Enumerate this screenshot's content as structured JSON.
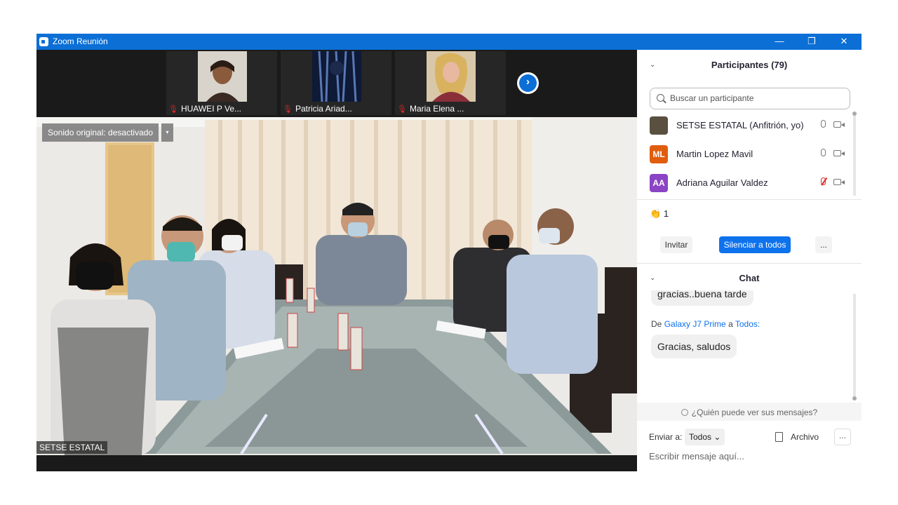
{
  "window": {
    "title": "Zoom Reunión",
    "minimize": "—",
    "restore": "❐",
    "close": "✕"
  },
  "thumbnails": [
    {
      "name": "HUAWEI P Ve...",
      "muted": true
    },
    {
      "name": "Patricia Ariad...",
      "muted": true
    },
    {
      "name": "Maria Elena ...",
      "muted": true
    }
  ],
  "video": {
    "sound_button": "Sonido original: desactivado",
    "sound_caret": "▾",
    "speaker_label": "SETSE ESTATAL",
    "next_icon": "›"
  },
  "participants": {
    "header": "Participantes (79)",
    "search_placeholder": "Buscar un participante",
    "list": [
      {
        "initials": "",
        "name": "SETSE ESTATAL (Anfitrión, yo)",
        "avatar_color": "#5a5040",
        "mic_muted": false
      },
      {
        "initials": "ML",
        "name": "Martin Lopez Mavil",
        "avatar_color": "#e05d0e",
        "mic_muted": false
      },
      {
        "initials": "AA",
        "name": "Adriana Aguilar Valdez",
        "avatar_color": "#8b44c4",
        "mic_muted": true
      }
    ],
    "reaction_icon": "👏",
    "reaction_count": "1",
    "invite_button": "Invitar",
    "mute_all_button": "Silenciar a todos",
    "more_button": "..."
  },
  "chat": {
    "header": "Chat",
    "prev_message": "gracias..buena tarde",
    "from_prefix": "De",
    "from_sender": "Galaxy J7 Prime",
    "from_to": "a",
    "from_recipient": "Todos:",
    "message": "Gracias, saludos",
    "who_can_see": "¿Quién puede ver sus mensajes?",
    "send_to_label": "Enviar a:",
    "send_to_value": "Todos",
    "send_to_caret": "⌄",
    "file_label": "Archivo",
    "more_label": "...",
    "input_placeholder": "Escribir mensaje aquí..."
  },
  "colors": {
    "zoom_blue": "#0b6fd6",
    "button_blue": "#0e72ed",
    "muted_red": "#e02828"
  }
}
